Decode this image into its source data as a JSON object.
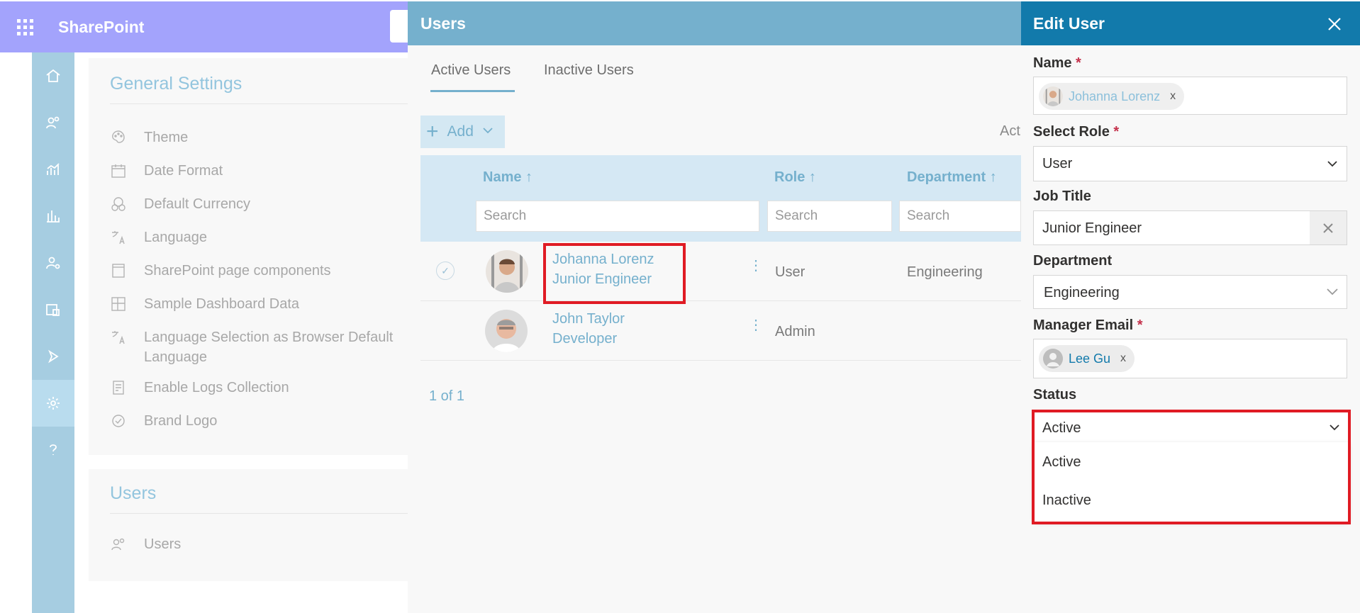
{
  "suite": {
    "app_name": "SharePoint"
  },
  "settings": {
    "title": "General Settings",
    "items": [
      {
        "label": "Theme",
        "icon": "palette-icon"
      },
      {
        "label": "Date Format",
        "icon": "calendar-icon"
      },
      {
        "label": "Default Currency",
        "icon": "currency-icon"
      },
      {
        "label": "Language",
        "icon": "translate-icon"
      },
      {
        "label": "SharePoint page components",
        "icon": "page-icon"
      },
      {
        "label": "Sample Dashboard Data",
        "icon": "dashboard-icon"
      },
      {
        "label": "Language Selection as Browser Default Language",
        "icon": "translate-icon"
      },
      {
        "label": "Enable Logs Collection",
        "icon": "logs-icon"
      },
      {
        "label": "Brand Logo",
        "icon": "badge-icon"
      }
    ],
    "users_section_title": "Users",
    "users_item": "Users"
  },
  "users_panel": {
    "title": "Users",
    "tabs": [
      "Active Users",
      "Inactive Users"
    ],
    "add_label": "Add",
    "truncated_label": "Act",
    "columns": [
      "Name ↑",
      "Role ↑",
      "Department ↑"
    ],
    "search_placeholder": "Search",
    "rows": [
      {
        "name": "Johanna Lorenz",
        "title": "Junior Engineer",
        "role": "User",
        "department": "Engineering"
      },
      {
        "name": "John Taylor",
        "title": "Developer",
        "role": "Admin",
        "department": ""
      }
    ],
    "pager": "1 of 1"
  },
  "edit_panel": {
    "title": "Edit User",
    "name_label": "Name",
    "name_value": "Johanna Lorenz",
    "role_label": "Select Role",
    "role_value": "User",
    "job_label": "Job Title",
    "job_value": "Junior Engineer",
    "dept_label": "Department",
    "dept_value": "Engineering",
    "manager_label": "Manager Email",
    "manager_value": "Lee Gu",
    "status_label": "Status",
    "status_value": "Active",
    "status_options": [
      "Active",
      "Inactive"
    ],
    "required_mark": "*",
    "remove_mark": "x"
  },
  "colors": {
    "suite_bar": "#a3a3fc",
    "panel_header": "#75b0cd",
    "edit_header": "#127aab",
    "highlight": "#e01b24"
  }
}
